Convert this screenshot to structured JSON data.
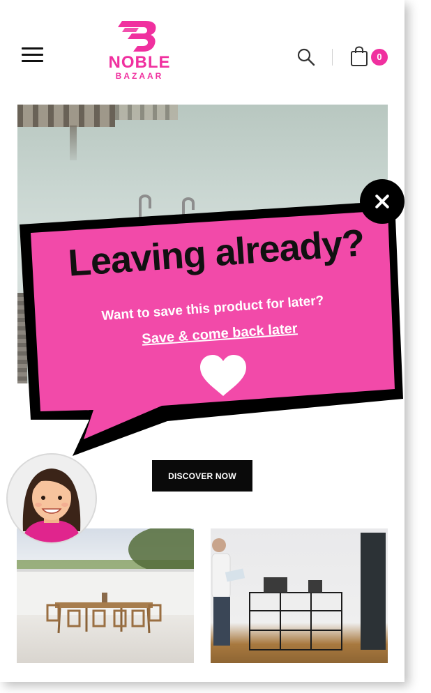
{
  "header": {
    "brand_name": "NOBLE",
    "brand_sub": "BAZAAR",
    "cart_count": "0",
    "accent_color": "#f0309f",
    "icons": [
      "menu-icon",
      "logo-icon",
      "search-icon",
      "shopping-bag-icon"
    ]
  },
  "main": {
    "discover_label": "DISCOVER NOW"
  },
  "popup": {
    "title": "Leaving already?",
    "subtitle": "Want to save this product for later?",
    "link_label": "Save & come back later",
    "background_color": "#f24aa9",
    "icons": [
      "close-icon",
      "heart-icon",
      "agent-avatar"
    ]
  }
}
